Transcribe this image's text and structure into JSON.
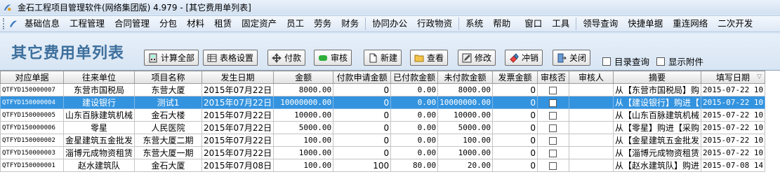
{
  "window": {
    "title": "金石工程项目管理软件(网络集团版) 4.979 - [其它费用单列表]"
  },
  "menu": [
    {
      "label": "基础信息"
    },
    {
      "label": "工程管理"
    },
    {
      "label": "合同管理"
    },
    {
      "label": "分包"
    },
    {
      "label": "材料"
    },
    {
      "label": "租赁"
    },
    {
      "label": "固定资产"
    },
    {
      "label": "员工"
    },
    {
      "label": "劳务"
    },
    {
      "label": "财务"
    },
    {
      "label": "协同办公"
    },
    {
      "label": "行政物资"
    },
    {
      "label": "系统"
    },
    {
      "label": "帮助"
    },
    {
      "label": "窗口"
    },
    {
      "label": "工具"
    },
    {
      "label": "领导查询"
    },
    {
      "label": "快捷单据"
    },
    {
      "label": "重连网络"
    },
    {
      "label": "二次开发"
    }
  ],
  "page": {
    "title": "其它费用单列表"
  },
  "toolbar": {
    "calc_all": "计算全部",
    "table_settings": "表格设置",
    "pay": "付款",
    "audit": "审核",
    "new": "新建",
    "view": "查看",
    "edit": "修改",
    "reverse": "冲销",
    "close": "关闭",
    "dir_query": "目录查询",
    "show_attach": "显示附件"
  },
  "table": {
    "columns": [
      "对应单据",
      "往来单位",
      "项目名称",
      "发生日期",
      "金额",
      "付款申请金额",
      "已付款金额",
      "未付款金额",
      "发票金额",
      "审核否",
      "审核人",
      "摘要",
      "填写日期"
    ],
    "rows": [
      {
        "code": "QTFYD150000007",
        "unit": "东营市国税局",
        "project": "东营大厦",
        "date": "2015年07月22日",
        "amount": "8000.00",
        "apply": "0",
        "paid": "0.00",
        "unpaid": "8000.00",
        "invoice": "0",
        "auditor": "",
        "summary": "从【东营市国税局】购",
        "filled": "2015-07-22 10"
      },
      {
        "code": "QTFYD150000004",
        "unit": "建设银行",
        "project": "测试1",
        "date": "2015年07月22日",
        "amount": "10000000.00",
        "apply": "0",
        "paid": "0.00",
        "unpaid": "10000000.00",
        "invoice": "0",
        "auditor": "",
        "summary": "从【建设银行】购进【",
        "filled": "2015-07-22 10"
      },
      {
        "code": "QTFYD150000005",
        "unit": "山东百脉建筑机械",
        "project": "金石大楼",
        "date": "2015年07月22日",
        "amount": "10000.00",
        "apply": "0",
        "paid": "0.00",
        "unpaid": "10000.00",
        "invoice": "0",
        "auditor": "",
        "summary": "从【山东百脉建筑机械",
        "filled": "2015-07-22 10"
      },
      {
        "code": "QTFYD150000006",
        "unit": "零星",
        "project": "人民医院",
        "date": "2015年07月22日",
        "amount": "5000.00",
        "apply": "0",
        "paid": "0.00",
        "unpaid": "5000.00",
        "invoice": "0",
        "auditor": "",
        "summary": "从【零星】购进【采购",
        "filled": "2015-07-22 10"
      },
      {
        "code": "QTFYD150000002",
        "unit": "金星建筑五金批发",
        "project": "东营大厦二期",
        "date": "2015年07月22日",
        "amount": "100.00",
        "apply": "0",
        "paid": "0.00",
        "unpaid": "100.00",
        "invoice": "0",
        "auditor": "",
        "summary": "从【金星建筑五金批发",
        "filled": "2015-07-22 10"
      },
      {
        "code": "QTFYD150000003",
        "unit": "淄博元成物资租赁",
        "project": "东营大厦一期",
        "date": "2015年07月22日",
        "amount": "1000.00",
        "apply": "0",
        "paid": "0.00",
        "unpaid": "1000.00",
        "invoice": "0",
        "auditor": "",
        "summary": "从【淄博元成物资租赁",
        "filled": "2015-07-22 10"
      },
      {
        "code": "QTFYD150000001",
        "unit": "赵水建筑队",
        "project": "金石大厦",
        "date": "2015年07月08日",
        "amount": "100.00",
        "apply": "100",
        "paid": "80.00",
        "unpaid": "20.00",
        "invoice": "0",
        "auditor": "",
        "summary": "从【赵水建筑队】购进",
        "filled": "2015-07-08 14"
      }
    ],
    "selected_index": 1
  },
  "colors": {
    "title": "#3d6f9c",
    "selected_row": "#3393df",
    "audit_button": "#2fae3a"
  }
}
